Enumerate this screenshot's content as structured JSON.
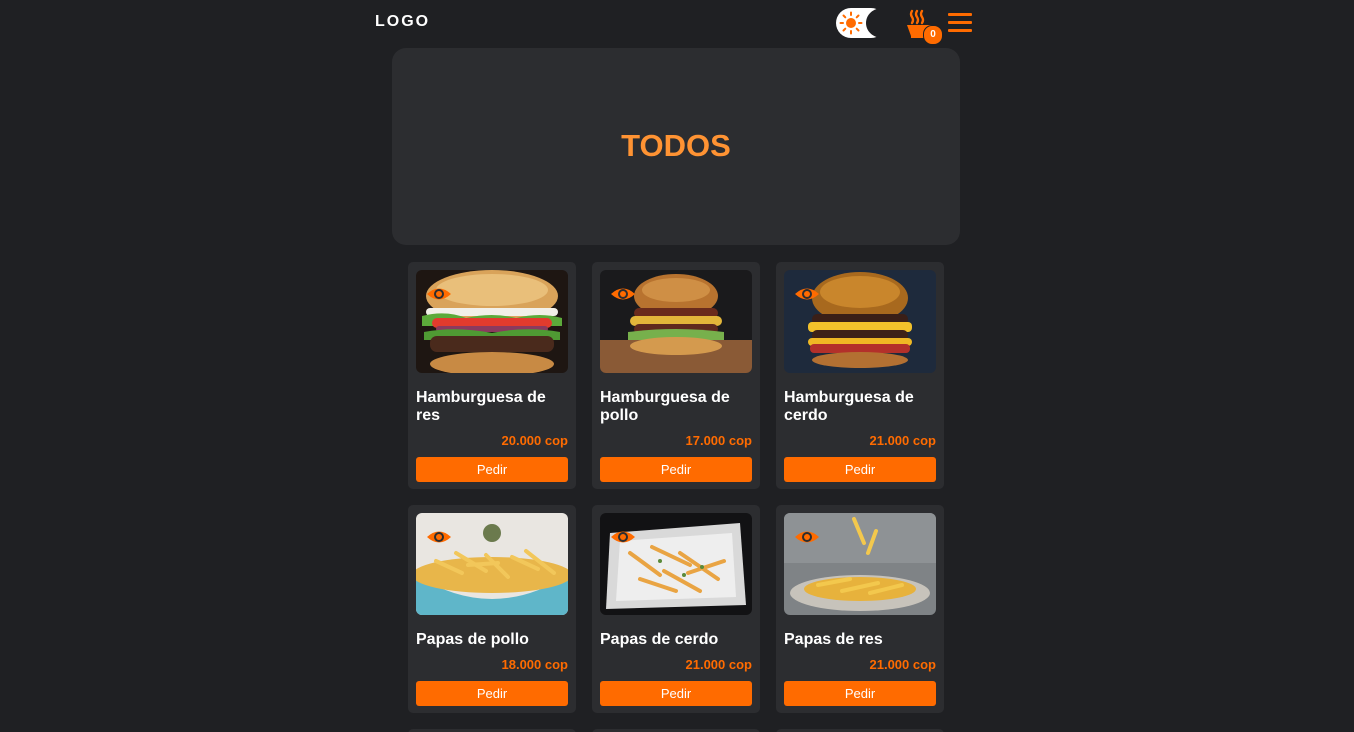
{
  "header": {
    "logo": "LOGO",
    "cart_count": "0",
    "icons": {
      "theme_light": "sun-icon",
      "theme_dark": "moon-icon",
      "cart": "cart-icon",
      "menu": "menu-icon"
    }
  },
  "banner": {
    "title": "TODOS"
  },
  "colors": {
    "accent": "#ff6b00",
    "banner_title": "#ff9333",
    "background": "#1f2023",
    "card": "#2c2d30"
  },
  "products": [
    {
      "name": "Hamburguesa de res",
      "price": "20.000 cop",
      "button": "Pedir",
      "kind": "burger",
      "image": "beef-burger-photo"
    },
    {
      "name": "Hamburguesa de pollo",
      "price": "17.000 cop",
      "button": "Pedir",
      "kind": "burger",
      "image": "chicken-burger-photo"
    },
    {
      "name": "Hamburguesa de cerdo",
      "price": "21.000 cop",
      "button": "Pedir",
      "kind": "burger",
      "image": "pork-burger-photo"
    },
    {
      "name": "Papas de pollo",
      "price": "18.000 cop",
      "button": "Pedir",
      "kind": "fries",
      "image": "fries-bowl-photo"
    },
    {
      "name": "Papas de cerdo",
      "price": "21.000 cop",
      "button": "Pedir",
      "kind": "fries",
      "image": "fries-basket-photo"
    },
    {
      "name": "Papas de res",
      "price": "21.000 cop",
      "button": "Pedir",
      "kind": "fries",
      "image": "fries-plate-photo"
    }
  ]
}
